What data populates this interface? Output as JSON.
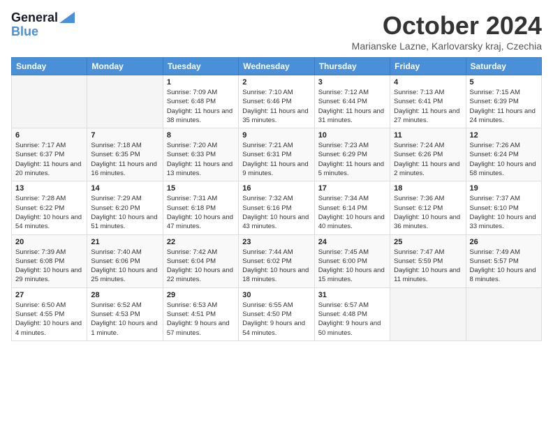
{
  "logo": {
    "line1": "General",
    "line2": "Blue"
  },
  "title": "October 2024",
  "location": "Marianske Lazne, Karlovarsky kraj, Czechia",
  "days_of_week": [
    "Sunday",
    "Monday",
    "Tuesday",
    "Wednesday",
    "Thursday",
    "Friday",
    "Saturday"
  ],
  "weeks": [
    [
      {
        "day": "",
        "info": ""
      },
      {
        "day": "",
        "info": ""
      },
      {
        "day": "1",
        "info": "Sunrise: 7:09 AM\nSunset: 6:48 PM\nDaylight: 11 hours and 38 minutes."
      },
      {
        "day": "2",
        "info": "Sunrise: 7:10 AM\nSunset: 6:46 PM\nDaylight: 11 hours and 35 minutes."
      },
      {
        "day": "3",
        "info": "Sunrise: 7:12 AM\nSunset: 6:44 PM\nDaylight: 11 hours and 31 minutes."
      },
      {
        "day": "4",
        "info": "Sunrise: 7:13 AM\nSunset: 6:41 PM\nDaylight: 11 hours and 27 minutes."
      },
      {
        "day": "5",
        "info": "Sunrise: 7:15 AM\nSunset: 6:39 PM\nDaylight: 11 hours and 24 minutes."
      }
    ],
    [
      {
        "day": "6",
        "info": "Sunrise: 7:17 AM\nSunset: 6:37 PM\nDaylight: 11 hours and 20 minutes."
      },
      {
        "day": "7",
        "info": "Sunrise: 7:18 AM\nSunset: 6:35 PM\nDaylight: 11 hours and 16 minutes."
      },
      {
        "day": "8",
        "info": "Sunrise: 7:20 AM\nSunset: 6:33 PM\nDaylight: 11 hours and 13 minutes."
      },
      {
        "day": "9",
        "info": "Sunrise: 7:21 AM\nSunset: 6:31 PM\nDaylight: 11 hours and 9 minutes."
      },
      {
        "day": "10",
        "info": "Sunrise: 7:23 AM\nSunset: 6:29 PM\nDaylight: 11 hours and 5 minutes."
      },
      {
        "day": "11",
        "info": "Sunrise: 7:24 AM\nSunset: 6:26 PM\nDaylight: 11 hours and 2 minutes."
      },
      {
        "day": "12",
        "info": "Sunrise: 7:26 AM\nSunset: 6:24 PM\nDaylight: 10 hours and 58 minutes."
      }
    ],
    [
      {
        "day": "13",
        "info": "Sunrise: 7:28 AM\nSunset: 6:22 PM\nDaylight: 10 hours and 54 minutes."
      },
      {
        "day": "14",
        "info": "Sunrise: 7:29 AM\nSunset: 6:20 PM\nDaylight: 10 hours and 51 minutes."
      },
      {
        "day": "15",
        "info": "Sunrise: 7:31 AM\nSunset: 6:18 PM\nDaylight: 10 hours and 47 minutes."
      },
      {
        "day": "16",
        "info": "Sunrise: 7:32 AM\nSunset: 6:16 PM\nDaylight: 10 hours and 43 minutes."
      },
      {
        "day": "17",
        "info": "Sunrise: 7:34 AM\nSunset: 6:14 PM\nDaylight: 10 hours and 40 minutes."
      },
      {
        "day": "18",
        "info": "Sunrise: 7:36 AM\nSunset: 6:12 PM\nDaylight: 10 hours and 36 minutes."
      },
      {
        "day": "19",
        "info": "Sunrise: 7:37 AM\nSunset: 6:10 PM\nDaylight: 10 hours and 33 minutes."
      }
    ],
    [
      {
        "day": "20",
        "info": "Sunrise: 7:39 AM\nSunset: 6:08 PM\nDaylight: 10 hours and 29 minutes."
      },
      {
        "day": "21",
        "info": "Sunrise: 7:40 AM\nSunset: 6:06 PM\nDaylight: 10 hours and 25 minutes."
      },
      {
        "day": "22",
        "info": "Sunrise: 7:42 AM\nSunset: 6:04 PM\nDaylight: 10 hours and 22 minutes."
      },
      {
        "day": "23",
        "info": "Sunrise: 7:44 AM\nSunset: 6:02 PM\nDaylight: 10 hours and 18 minutes."
      },
      {
        "day": "24",
        "info": "Sunrise: 7:45 AM\nSunset: 6:00 PM\nDaylight: 10 hours and 15 minutes."
      },
      {
        "day": "25",
        "info": "Sunrise: 7:47 AM\nSunset: 5:59 PM\nDaylight: 10 hours and 11 minutes."
      },
      {
        "day": "26",
        "info": "Sunrise: 7:49 AM\nSunset: 5:57 PM\nDaylight: 10 hours and 8 minutes."
      }
    ],
    [
      {
        "day": "27",
        "info": "Sunrise: 6:50 AM\nSunset: 4:55 PM\nDaylight: 10 hours and 4 minutes."
      },
      {
        "day": "28",
        "info": "Sunrise: 6:52 AM\nSunset: 4:53 PM\nDaylight: 10 hours and 1 minute."
      },
      {
        "day": "29",
        "info": "Sunrise: 6:53 AM\nSunset: 4:51 PM\nDaylight: 9 hours and 57 minutes."
      },
      {
        "day": "30",
        "info": "Sunrise: 6:55 AM\nSunset: 4:50 PM\nDaylight: 9 hours and 54 minutes."
      },
      {
        "day": "31",
        "info": "Sunrise: 6:57 AM\nSunset: 4:48 PM\nDaylight: 9 hours and 50 minutes."
      },
      {
        "day": "",
        "info": ""
      },
      {
        "day": "",
        "info": ""
      }
    ]
  ]
}
